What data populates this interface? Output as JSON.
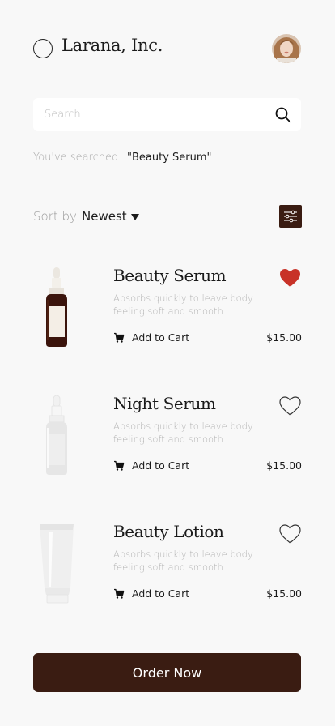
{
  "header": {
    "brand": "Larana, Inc."
  },
  "search": {
    "placeholder": "Search",
    "value": "",
    "searched_label": "You've searched",
    "searched_value": "\"Beauty Serum\""
  },
  "sort": {
    "label": "Sort by",
    "value": "Newest"
  },
  "products": [
    {
      "name": "Beauty Serum",
      "description": "Absorbs quickly to leave body feeling soft and smooth.",
      "add_to_cart": "Add to Cart",
      "price": "$15.00",
      "favorited": true,
      "image": "amber-dropper-bottle"
    },
    {
      "name": "Night Serum",
      "description": "Absorbs quickly to leave body feeling soft and smooth.",
      "add_to_cart": "Add to Cart",
      "price": "$15.00",
      "favorited": false,
      "image": "white-dropper-bottle"
    },
    {
      "name": "Beauty Lotion",
      "description": "Absorbs quickly to leave body feeling soft and smooth.",
      "add_to_cart": "Add to Cart",
      "price": "$15.00",
      "favorited": false,
      "image": "white-lotion-tube"
    }
  ],
  "order_button": {
    "label": "Order Now"
  },
  "colors": {
    "background": "#f8f8f8",
    "accent": "#3a1c12",
    "heart_filled": "#c83228",
    "muted_text": "#b3b3b3"
  },
  "icons": {
    "search": "search-icon",
    "filter": "sliders-icon",
    "cart": "cart-icon",
    "heart": "heart-icon",
    "caret": "caret-down-icon"
  }
}
